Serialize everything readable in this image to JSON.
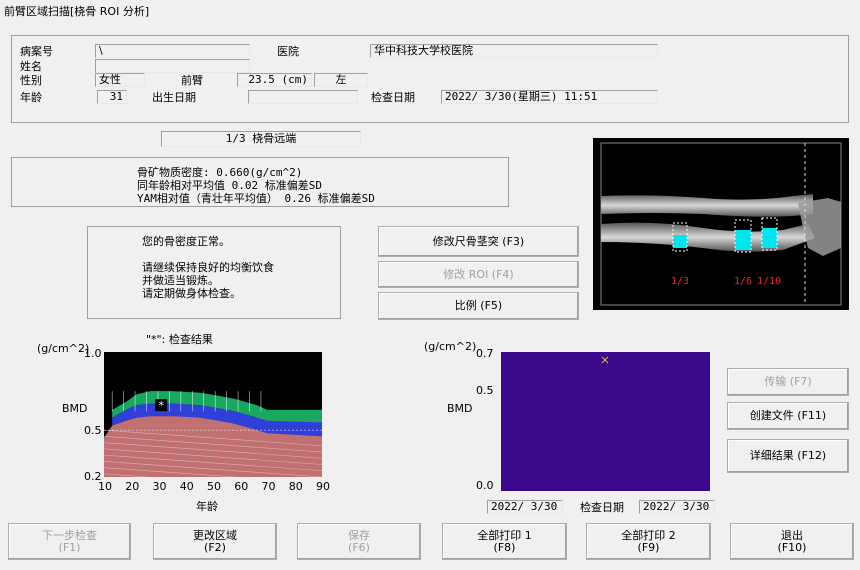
{
  "window": {
    "title": "前臂区域扫描[桡骨 ROI 分析]"
  },
  "patient": {
    "case_no_label": "病案号",
    "case_no_value": "\\",
    "name_label": "姓名",
    "name_value": "",
    "hospital_label": "医院",
    "hospital_value": "华中科技大学校医院",
    "sex_label": "性别",
    "sex_value": "女性",
    "forearm_label": "前臂",
    "forearm_value": "23.5 (cm)",
    "side_value": "左",
    "age_label": "年龄",
    "age_value": "31",
    "birth_label": "出生日期",
    "birth_value": "",
    "exam_date_label": "检查日期",
    "exam_date_value": "2022/ 3/30(星期三) 11:51"
  },
  "region": {
    "label": "1/3 桡骨远端"
  },
  "results": {
    "bmd_line": "骨矿物质密度:  0.660(g/cm^2)",
    "age_line": "同年龄相对平均值  0.02 标准偏差SD",
    "yam_line": "YAM相对值（青壮年平均值）  0.26 标准偏差SD"
  },
  "advice": {
    "line1": "您的骨密度正常。",
    "line2": "请继续保持良好的均衡饮食",
    "line3": "并做适当锻炼。",
    "line4": "请定期做身体检查。"
  },
  "buttons": {
    "modify_ulna": "修改尺骨茎突 (F3)",
    "modify_roi": "修改 ROI (F4)",
    "ratio": "比例 (F5)",
    "transfer": "传输 (F7)",
    "create_file": "创建文件 (F11)",
    "details": "详细结果 (F12)",
    "next_l1": "下一步检查",
    "next_l2": "(F1)",
    "change_l1": "更改区域",
    "change_l2": "(F2)",
    "save_l1": "保存",
    "save_l2": "(F6)",
    "print1_l1": "全部打印 1",
    "print1_l2": "(F8)",
    "print2_l1": "全部打印 2",
    "print2_l2": "(F9)",
    "exit_l1": "退出",
    "exit_l2": "(F10)"
  },
  "xray": {
    "labels": [
      "1/3",
      "1/6",
      "1/10"
    ],
    "roi_color": "#00e5ee"
  },
  "chart_data": [
    {
      "type": "area",
      "title": "\"*\": 检查结果",
      "ylabel": "BMD",
      "yunit": "(g/cm^2)",
      "xlabel": "年龄",
      "xlim": [
        10,
        90
      ],
      "ylim": [
        0.2,
        1.0
      ],
      "yticks": [
        "1.0",
        "0.5",
        "0.2"
      ],
      "xticks": [
        "10",
        "20",
        "30",
        "40",
        "50",
        "60",
        "70",
        "80",
        "90"
      ],
      "marker": {
        "x": 31,
        "y": 0.66,
        "label": "*"
      },
      "colors": {
        "green": "#18a860",
        "blue": "#2f3fd8",
        "pink": "#c07070",
        "bg": "#000000"
      }
    },
    {
      "type": "scatter",
      "ylabel": "BMD",
      "yunit": "(g/cm^2)",
      "ylim": [
        0.0,
        0.7
      ],
      "yticks": [
        "0.7",
        "0.5",
        "0.0"
      ],
      "points": [
        {
          "x": "2022/ 3/30",
          "y": 0.66
        }
      ],
      "x_start": "2022/ 3/30",
      "x_label": "检查日期",
      "x_end": "2022/ 3/30",
      "colors": {
        "bg": "#3b0a8c",
        "point": "#e8c828"
      }
    }
  ]
}
